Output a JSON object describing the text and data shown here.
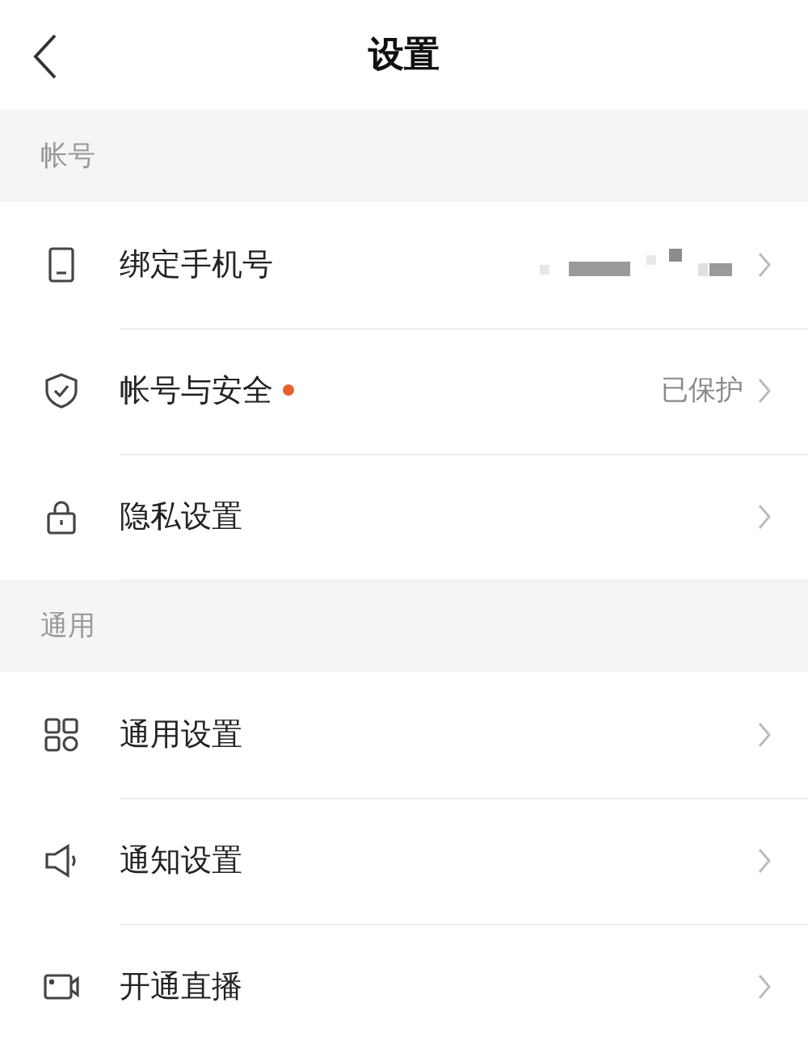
{
  "header": {
    "title": "设置"
  },
  "sections": [
    {
      "title": "帐号",
      "items": [
        {
          "label": "绑定手机号",
          "masked": true,
          "dot": false
        },
        {
          "label": "帐号与安全",
          "value": "已保护",
          "masked": false,
          "dot": true
        },
        {
          "label": "隐私设置",
          "masked": false,
          "dot": false
        }
      ]
    },
    {
      "title": "通用",
      "items": [
        {
          "label": "通用设置",
          "masked": false,
          "dot": false
        },
        {
          "label": "通知设置",
          "masked": false,
          "dot": false
        },
        {
          "label": "开通直播",
          "masked": false,
          "dot": false
        }
      ]
    }
  ]
}
